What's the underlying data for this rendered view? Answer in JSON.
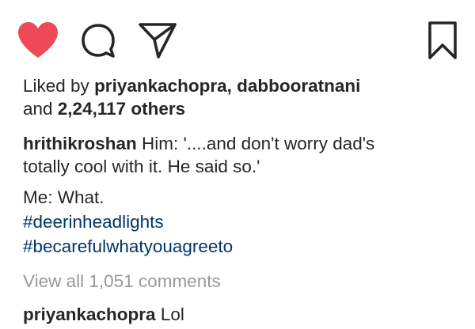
{
  "actions": {
    "like_icon": "heart-filled-icon",
    "comment_icon": "comment-bubble-icon",
    "share_icon": "paper-plane-icon",
    "save_icon": "bookmark-icon",
    "like_color": "#ed4956"
  },
  "likes": {
    "prefix": "Liked by ",
    "user1": "priyankachopra",
    "separator": ", ",
    "user2": "dabbooratnani",
    "and": "and ",
    "others": "2,24,117 others"
  },
  "caption": {
    "username": "hrithikroshan",
    "line1": " Him: '....and don't worry dad's",
    "line2": "totally cool with it. He said so.'",
    "line3": "Me: What.",
    "hashtag1": "#deerinheadlights",
    "hashtag2": "#becarefulwhatyouagreeto"
  },
  "view_all": "View all 1,051 comments",
  "comment": {
    "username": "priyankachopra",
    "text": " Lol"
  }
}
